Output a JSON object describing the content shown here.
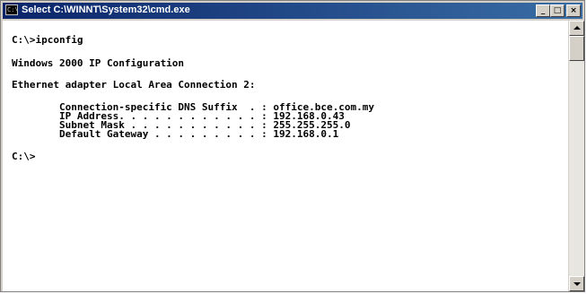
{
  "window": {
    "title": "Select C:\\WINNT\\System32\\cmd.exe",
    "icon_glyph": "C:\\",
    "icon_name": "cmd-app-icon",
    "controls": {
      "minimize": "_",
      "maximize": "□",
      "close": "×"
    }
  },
  "console": {
    "lines": [
      "C:\\>ipconfig",
      "Windows 2000 IP Configuration",
      "Ethernet adapter Local Area Connection 2:",
      "        Connection-specific DNS Suffix  . : office.bce.com.my",
      "        IP Address. . . . . . . . . . . . : 192.168.0.43",
      "        Subnet Mask . . . . . . . . . . . : 255.255.255.0",
      "        Default Gateway . . . . . . . . . : 192.168.0.1",
      "C:\\>"
    ]
  },
  "colors": {
    "titlebar_start": "#0a246a",
    "titlebar_end": "#3a6ea5",
    "console_background": "#ffffff",
    "console_text": "#000000",
    "chrome": "#d4d0c8"
  }
}
